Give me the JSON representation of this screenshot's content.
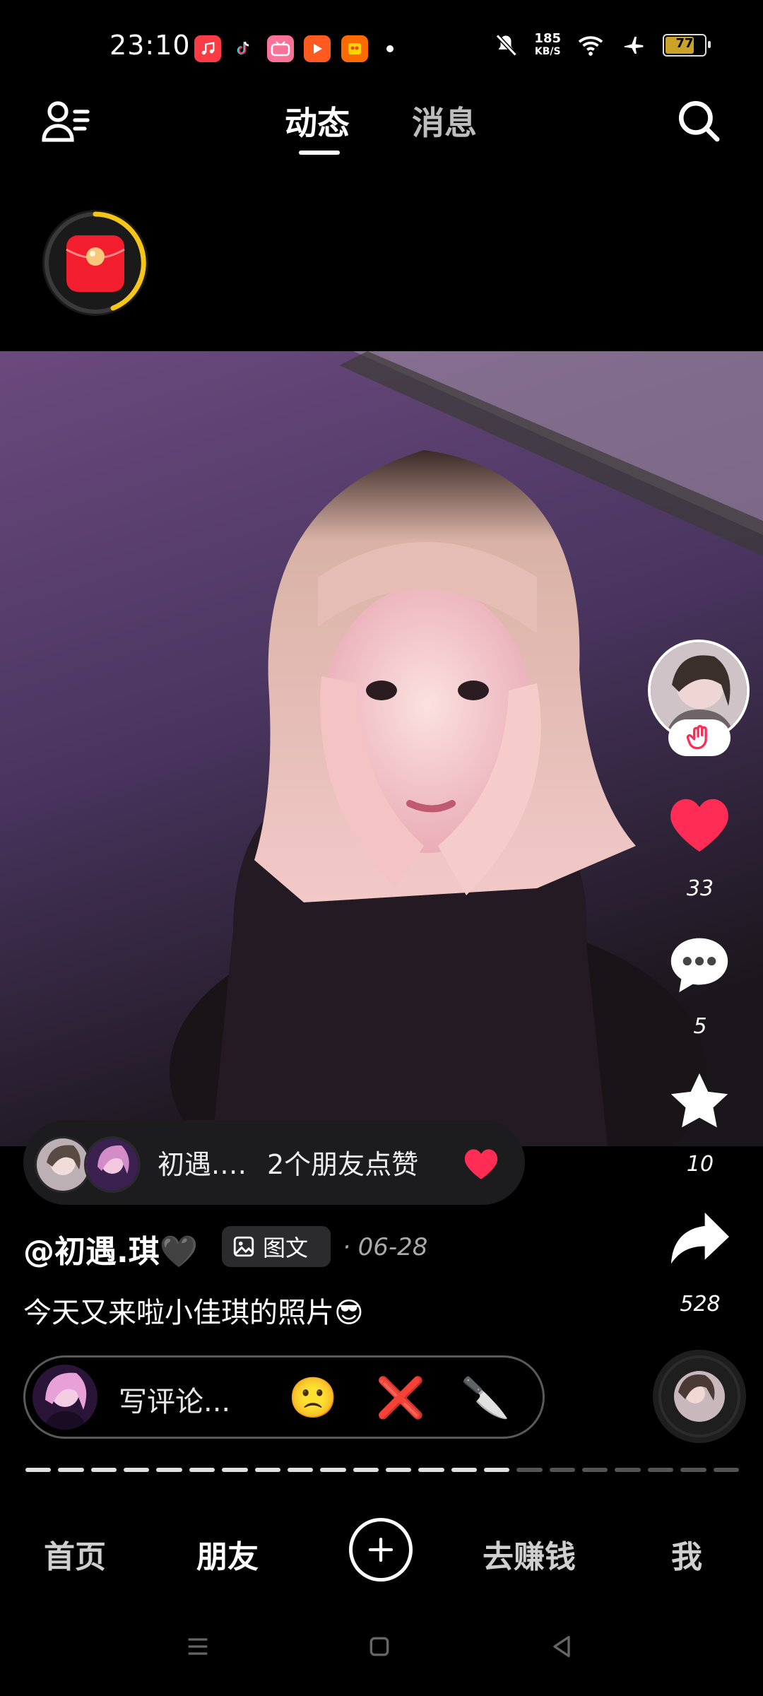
{
  "status_bar": {
    "time": "23:10",
    "network_speed_value": "185",
    "network_speed_unit": "KB/S",
    "battery_level": "77",
    "app_icons": [
      "music-icon",
      "tiktok-icon",
      "bilibili-icon",
      "video-play-icon",
      "store-icon"
    ]
  },
  "top_nav": {
    "tabs": [
      {
        "label": "动态",
        "active": true
      },
      {
        "label": "消息",
        "active": false
      }
    ]
  },
  "post": {
    "side_actions": {
      "like_count": "33",
      "comment_count": "5",
      "favorite_count": "10",
      "share_count": "528"
    },
    "friends_liked": {
      "name": "初遇.…",
      "text": "2个朋友点赞"
    },
    "author": "@初遇.琪🖤",
    "type_badge": "图文",
    "date": "· 06-28",
    "caption": "今天又来啦小佳琪的照片😎"
  },
  "comment_bar": {
    "placeholder": "写评论...",
    "quick_reactions": [
      "🙁",
      "❌",
      "🔪"
    ]
  },
  "progress": {
    "total": 22,
    "viewed": 15
  },
  "bottom_nav": {
    "items": [
      {
        "label": "首页"
      },
      {
        "label": "朋友"
      },
      {
        "label": "去赚钱"
      },
      {
        "label": "我"
      }
    ]
  },
  "colors": {
    "background": "#000000",
    "like_red": "#ff2d55",
    "accent_gold": "#f5c518"
  }
}
